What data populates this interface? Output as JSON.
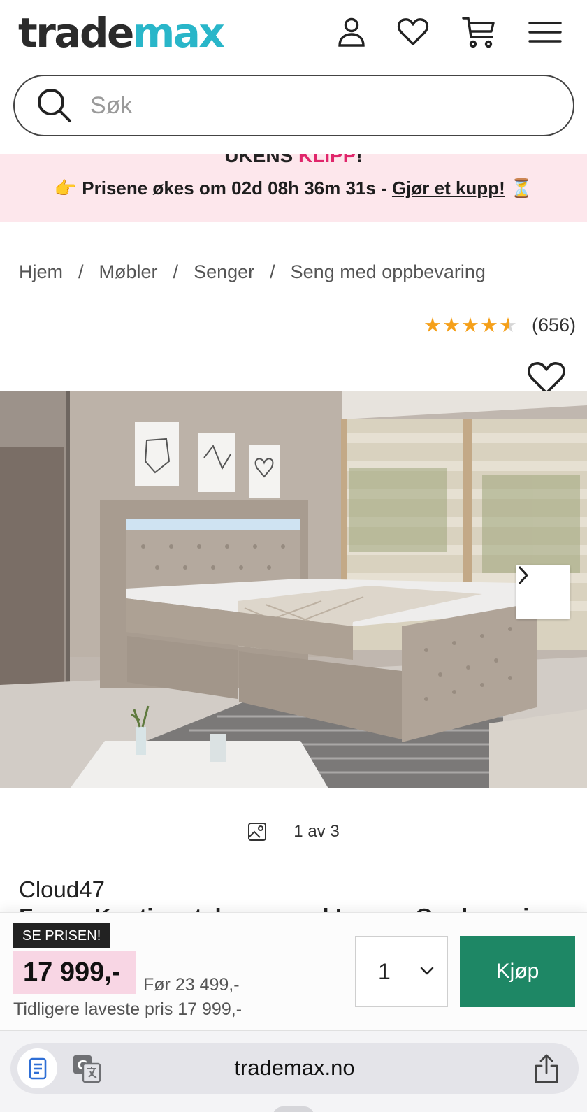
{
  "header": {
    "logo_part1": "trade",
    "logo_part2": "max",
    "icons": [
      "account-icon",
      "heart-icon",
      "cart-icon",
      "menu-icon"
    ]
  },
  "search": {
    "placeholder": "Søk"
  },
  "promo": {
    "title_part1": "UKENS ",
    "title_part2": "KLIPP",
    "title_part3": "!",
    "emoji_left": "👉",
    "text": "Prisene økes om 02d 08h 36m 31s - ",
    "link": "Gjør et kupp!",
    "emoji_right": "⏳"
  },
  "breadcrumb": {
    "items": [
      "Hjem",
      "Møbler",
      "Senger",
      "Seng med oppbevaring"
    ],
    "separator": "/"
  },
  "rating": {
    "stars": 4.5,
    "stars_full": "★★★★",
    "stars_half": "★",
    "count": "(656)"
  },
  "gallery": {
    "counter": "1 av 3"
  },
  "product": {
    "brand": "Cloud47",
    "name_partial": "Fuego Kontinentalseng med Lys og Oppbevaring"
  },
  "buybar": {
    "badge": "SE PRISEN!",
    "price": "17 999,-",
    "before_price": "Før 23 499,-",
    "lowest_price": "Tidligere laveste pris 17 999,-",
    "quantity": "1",
    "buy_label": "Kjøp"
  },
  "browser": {
    "url": "trademax.no"
  },
  "colors": {
    "logo_accent": "#29b6c9",
    "promo_bg": "#fde7ec",
    "promo_pink": "#e0266b",
    "price_bg": "#f8d6e4",
    "buy_button": "#1e8765",
    "stars": "#f5a01a"
  }
}
